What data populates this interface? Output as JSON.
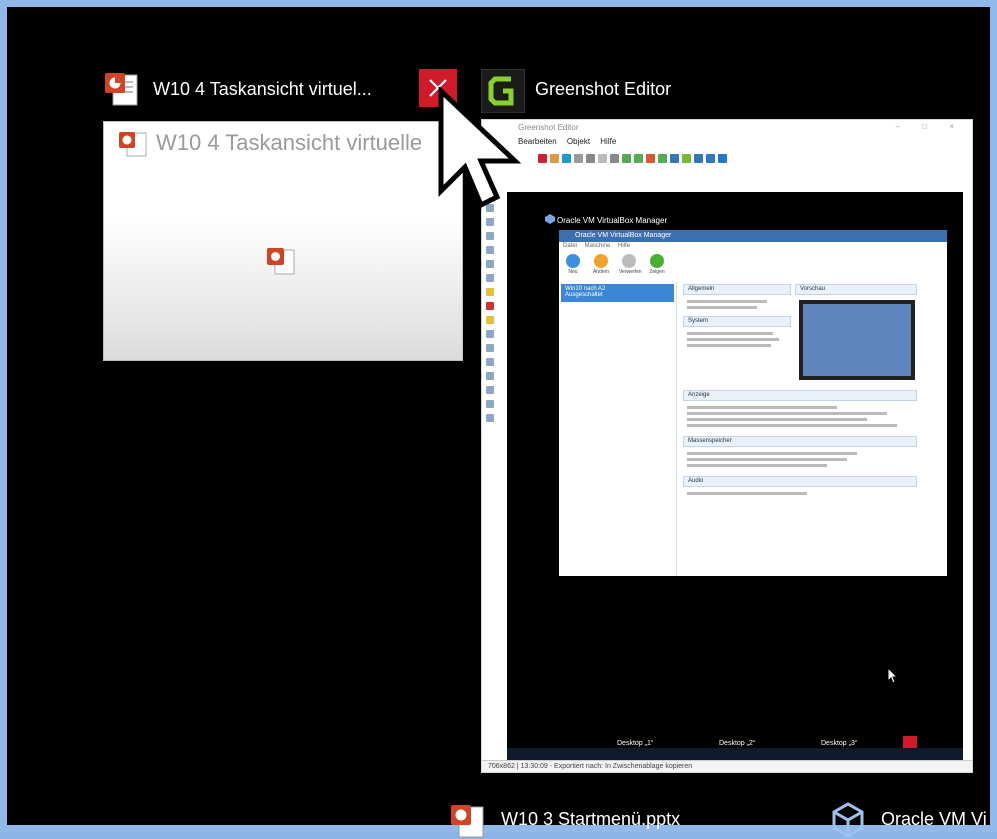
{
  "task_view": {
    "windows": [
      {
        "title": "W10 4 Taskansicht virtuel...",
        "thumbnail_caption": "W10 4 Taskansicht virtuelle",
        "icon": "powerpoint-icon",
        "close_label": "×"
      },
      {
        "title": "Greenshot Editor",
        "icon": "greenshot-icon",
        "inner": {
          "titlebar": "Greenshot Editor",
          "window_controls": "– □ ×",
          "menu": "Bearbeiten Objekt Hilfe",
          "status_bar": "706x862 | 13:30:09 - Exportiert nach: In Zwischenablage kopieren",
          "captured": {
            "caption": "Oracle VM VirtualBox Manager",
            "title": "Oracle VM VirtualBox Manager",
            "menu": "Datei Maschine Hilfe",
            "toolbar": [
              "Neu",
              "Ändern",
              "Verwerfen",
              "Zeigen"
            ],
            "vm_name": "Win10 nach A2",
            "vm_state": "Ausgeschaltet",
            "sections": [
              "Allgemein",
              "System",
              "Vorschau",
              "Anzeige",
              "Massenspeicher",
              "Audio"
            ],
            "desktops": [
              "Desktop „1“",
              "Desktop „2“",
              "Desktop „3“"
            ]
          }
        }
      }
    ],
    "bottom_items": [
      {
        "label": "W10 3 Startmenü.pptx",
        "icon": "powerpoint-icon"
      },
      {
        "label": "Oracle VM Vi",
        "icon": "virtualbox-icon"
      }
    ]
  }
}
